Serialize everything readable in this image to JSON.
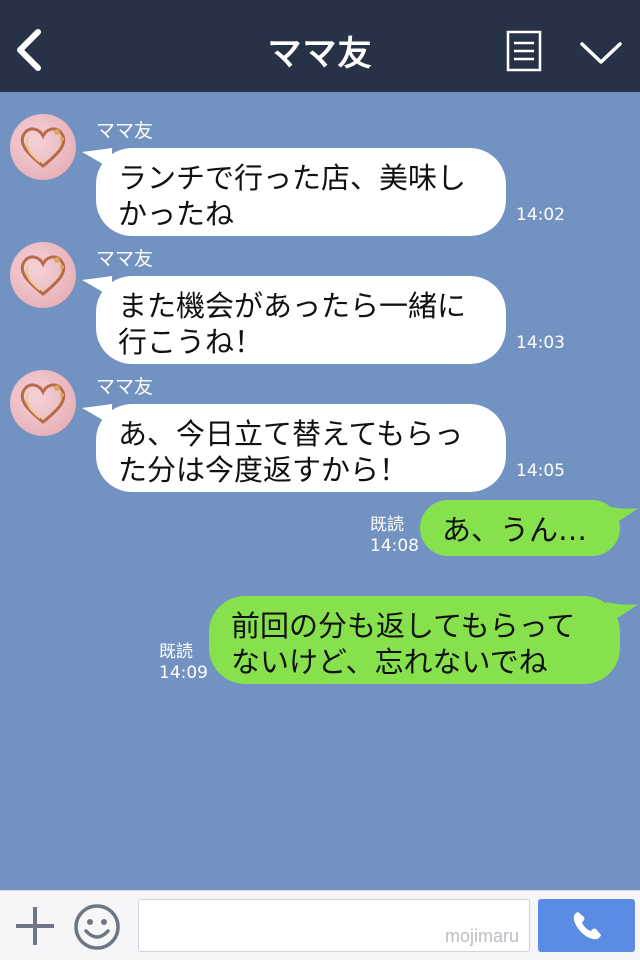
{
  "header": {
    "title": "ママ友",
    "back_icon": "chevron-left-icon",
    "menu_icon": "document-icon",
    "expand_icon": "chevron-down-icon"
  },
  "messages": [
    {
      "direction": "incoming",
      "sender": "ママ友",
      "lines": [
        "ランチで行った店、美味し",
        "かったね"
      ],
      "time": "14:02"
    },
    {
      "direction": "incoming",
      "sender": "ママ友",
      "lines": [
        "また機会があったら一緒に",
        "行こうね！"
      ],
      "time": "14:03"
    },
    {
      "direction": "incoming",
      "sender": "ママ友",
      "lines": [
        "あ、今日立て替えてもらっ",
        "た分は今度返すから！"
      ],
      "time": "14:05"
    },
    {
      "direction": "outgoing",
      "lines": [
        "あ、うん…"
      ],
      "read": "既読",
      "time": "14:08"
    },
    {
      "direction": "outgoing",
      "lines": [
        "前回の分も返してもらって",
        "ないけど、忘れないでね"
      ],
      "read": "既読",
      "time": "14:09"
    }
  ],
  "footer": {
    "plus_icon": "plus-icon",
    "emoji_icon": "smiley-icon",
    "input_value": "",
    "watermark": "mojimaru",
    "call_icon": "phone-icon"
  },
  "colors": {
    "background": "#7292c1",
    "header": "#283246",
    "incoming_bubble": "#ffffff",
    "outgoing_bubble": "#86e14c",
    "call_button": "#5a8ce6"
  }
}
